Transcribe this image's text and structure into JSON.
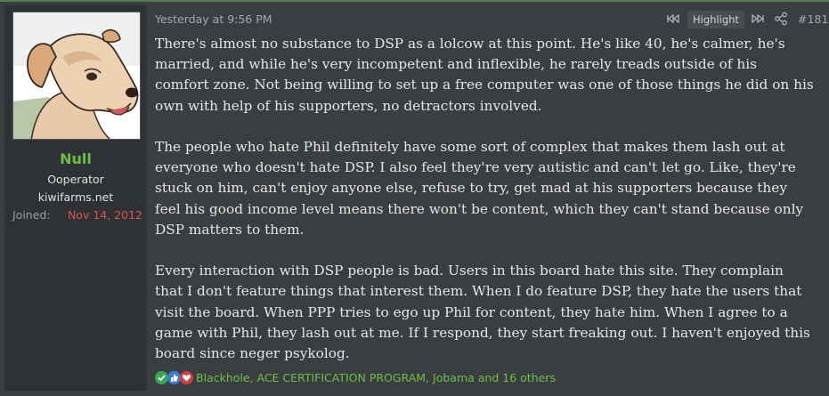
{
  "user": {
    "name": "Null",
    "title": "Ooperator",
    "site": "kiwifarms.net",
    "joined_label": "Joined:",
    "joined_value": "Nov 14, 2012"
  },
  "post": {
    "timestamp": "Yesterday at 9:56 PM",
    "highlight_label": "Highlight",
    "post_number": "#181",
    "paragraphs": [
      "There's almost no substance to DSP as a lolcow at this point. He's like 40, he's calmer, he's married, and while he's very incompetent and inflexible, he rarely treads outside of his comfort zone. Not being willing to set up a free computer was one of those things he did on his own with help of his supporters, no detractors involved.",
      "The people who hate Phil definitely have some sort of complex that makes them lash out at everyone who doesn't hate DSP. I also feel they're very autistic and can't let go. Like, they're stuck on him, can't enjoy anyone else, refuse to try, get mad at his supporters because they feel his good income level means there won't be content, which they can't stand because only DSP matters to them.",
      "Every interaction with DSP people is bad. Users in this board hate this site. They complain that I don't feature things that interest them. When I do feature DSP, they hate the users that visit the board. When PPP tries to ego up Phil for content, they hate him. When I agree to a game with Phil, they lash out at me. If I respond, they start freaking out. I haven't enjoyed this board since neger psykolog."
    ],
    "reactions_text": "Blackhole, ACE CERTIFICATION PROGRAM, Jobama and 16 others"
  },
  "icons": {
    "prev": "highlight-prev-icon",
    "next": "highlight-next-icon",
    "share": "share-icon",
    "reactions": [
      "check-reaction-icon",
      "thumbs-up-reaction-icon",
      "heart-reaction-icon"
    ]
  },
  "colors": {
    "accent_green": "#6bbf47",
    "joined_red": "#d9534f",
    "background": "#3b3e41",
    "user_pane": "#2f3234"
  }
}
